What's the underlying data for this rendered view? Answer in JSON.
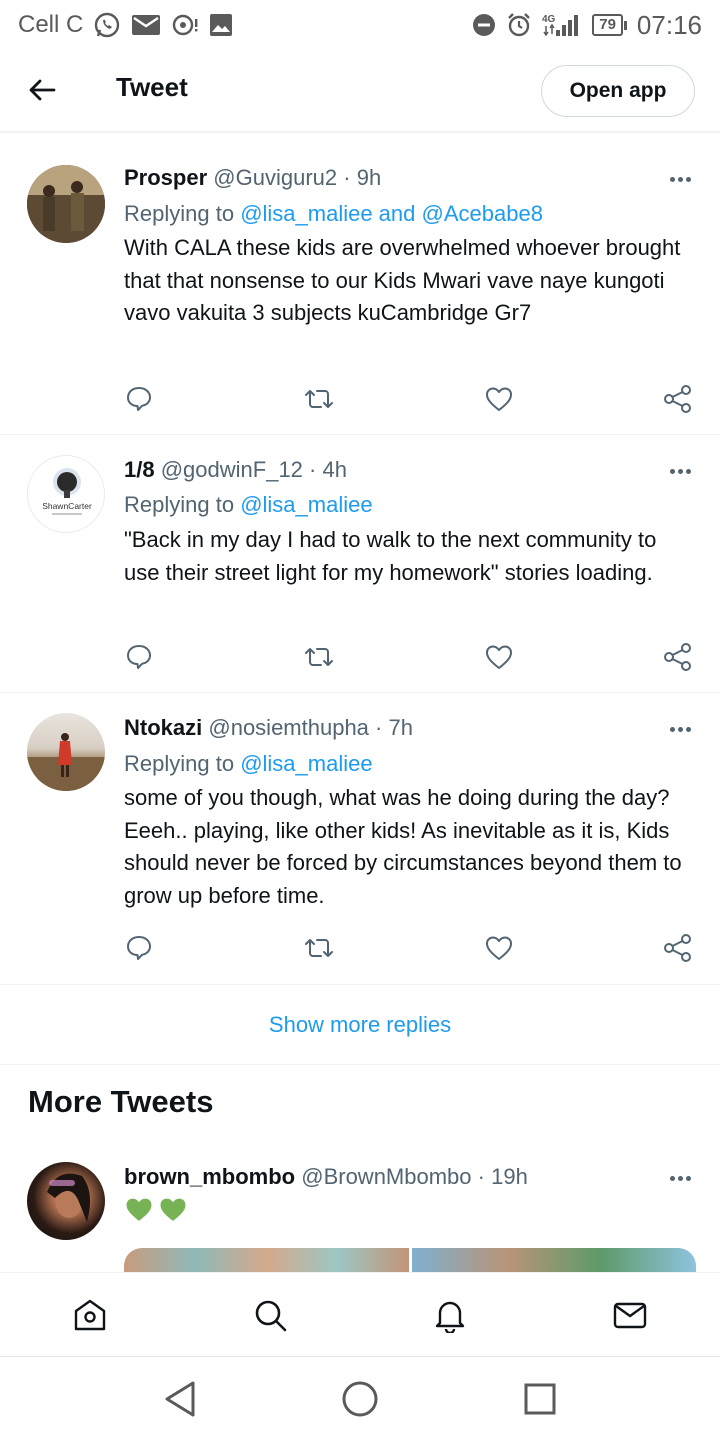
{
  "status_bar": {
    "carrier": "Cell C",
    "network": "4G",
    "battery": "79",
    "time": "07:16"
  },
  "header": {
    "title": "Tweet",
    "open_app_label": "Open app"
  },
  "tweets": [
    {
      "name": "Prosper",
      "handle": "@Guviguru2",
      "time": "9h",
      "replying_prefix": "Replying to ",
      "replying_to": "@lisa_maliee and @Acebabe8",
      "text": "With CALA these kids are overwhelmed whoever brought that that nonsense to our Kids Mwari vave naye kungoti vavo vakuita 3 subjects kuCambridge Gr7"
    },
    {
      "name": "1/8",
      "handle": "@godwinF_12",
      "time": "4h",
      "avatar_label": "ShawnCarter",
      "replying_prefix": "Replying to ",
      "replying_to": "@lisa_maliee",
      "text": "\"Back in my day I had to walk to the next community to  use their street light for my homework\" stories loading."
    },
    {
      "name": "Ntokazi",
      "handle": "@nosiemthupha",
      "time": "7h",
      "replying_prefix": "Replying to ",
      "replying_to": "@lisa_maliee",
      "text": "some of you though, what was he doing during the day? Eeeh.. playing, like other kids! As inevitable as it is, Kids should never be forced by circumstances beyond them to grow up before time."
    }
  ],
  "show_more_label": "Show more replies",
  "more_tweets_title": "More Tweets",
  "more_tweet": {
    "name": "brown_mbombo",
    "handle": "@BrownMbombo",
    "time": "19h",
    "text": "💚💚"
  },
  "colors": {
    "accent": "#1d9bf0",
    "text": "#0f1419",
    "secondary": "#536471",
    "heart_green": "#77b255"
  },
  "icons": {
    "back": "arrow-left-icon",
    "reply": "comment-icon",
    "retweet": "retweet-icon",
    "like": "heart-icon",
    "share": "share-icon",
    "home": "home-icon",
    "search": "search-icon",
    "notifications": "bell-icon",
    "messages": "mail-icon"
  }
}
